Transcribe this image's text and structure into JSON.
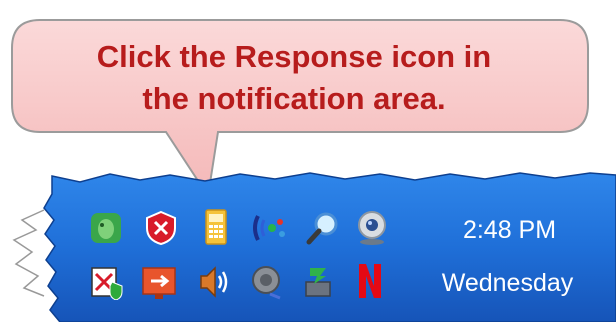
{
  "callout": {
    "line1": "Click the Response icon in",
    "line2": "the notification area."
  },
  "tray": {
    "clock_time": "2:48 PM",
    "clock_day": "Wednesday",
    "icons_row1": [
      "evernote-icon",
      "security-shield-icon",
      "response-phone-icon",
      "wireless-signal-icon",
      "search-magnifier-icon",
      "webcam-icon"
    ],
    "icons_row2": [
      "antivirus-icon",
      "usb-device-icon",
      "volume-speaker-icon",
      "audio-manager-icon",
      "network-connection-icon",
      "netflix-icon"
    ]
  },
  "colors": {
    "callout_fill": "#f7c6c6",
    "callout_border": "#9b9b9b",
    "callout_text": "#b71c1c",
    "taskbar_blue": "#1f6fd8",
    "taskbar_dark": "#1248a8"
  }
}
